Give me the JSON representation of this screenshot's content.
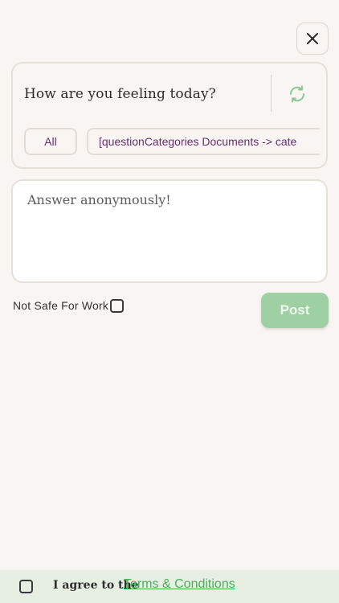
{
  "header": {
    "close_icon": "close-icon"
  },
  "question": {
    "text": "How are you feeling today?",
    "refresh_icon": "refresh-icon"
  },
  "categories": {
    "all_label": "All",
    "selected_label": "[questionCategories Documents -> cate"
  },
  "answer": {
    "placeholder": "Answer anonymously!"
  },
  "options": {
    "nsfw_label": "Not Safe For Work",
    "nsfw_checked": false
  },
  "post": {
    "label": "Post",
    "enabled": false
  },
  "footer": {
    "agree_text": "I agree to the",
    "terms_link": "Terms & Conditions",
    "agree_checked": false
  },
  "colors": {
    "background": "#f9f5f2",
    "accent_green": "#4cae5a",
    "post_button": "#9fd0a3",
    "category_text": "#6a2c73",
    "footer_bg": "#e7efe3"
  }
}
